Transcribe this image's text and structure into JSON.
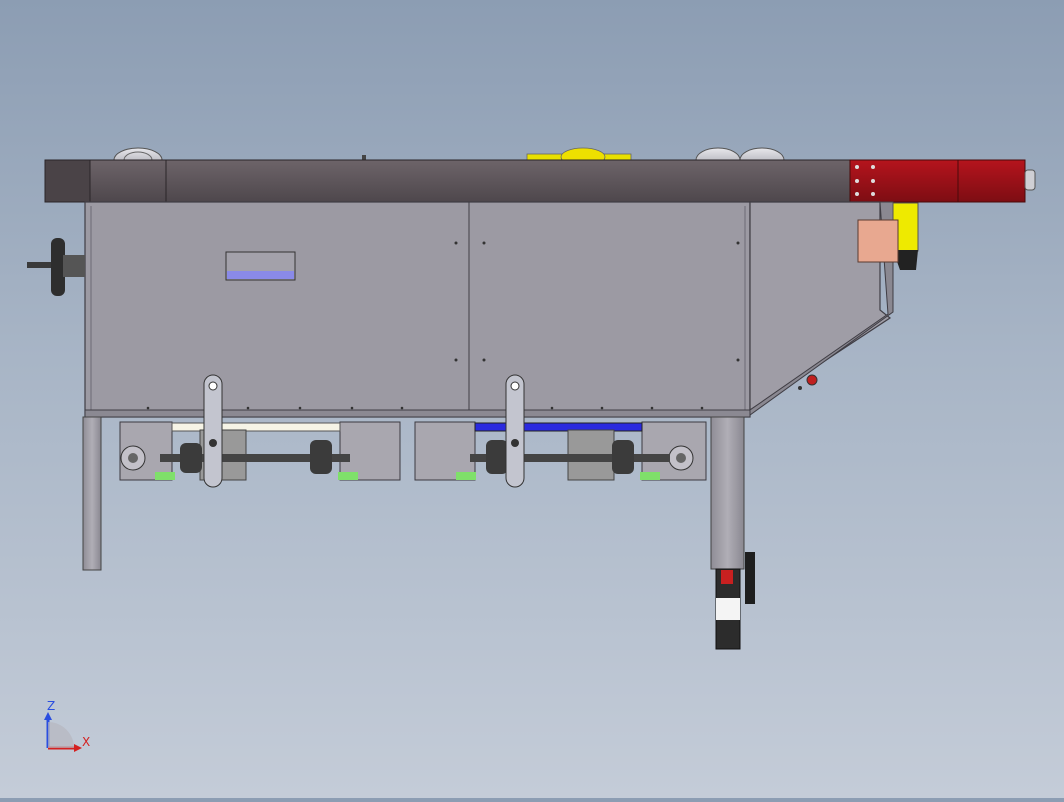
{
  "viewport": {
    "background_top": "#8c9db3",
    "background_bottom": "#c4ccd8"
  },
  "colors": {
    "top_beam": "#5f575d",
    "cabinet": "#9c9aa3",
    "cabinet_dark": "#7d7b85",
    "red_block": "#a0121a",
    "yellow_part": "#e8e000",
    "copper_part": "#e8a890",
    "blue_strip": "#2a2adf",
    "label_plate": "#8a8ae8",
    "green_pad": "#7fe06a"
  },
  "triad": {
    "z_label": "Z",
    "x_label": "X",
    "z_color": "#2a4ee0",
    "x_color": "#d42020"
  }
}
